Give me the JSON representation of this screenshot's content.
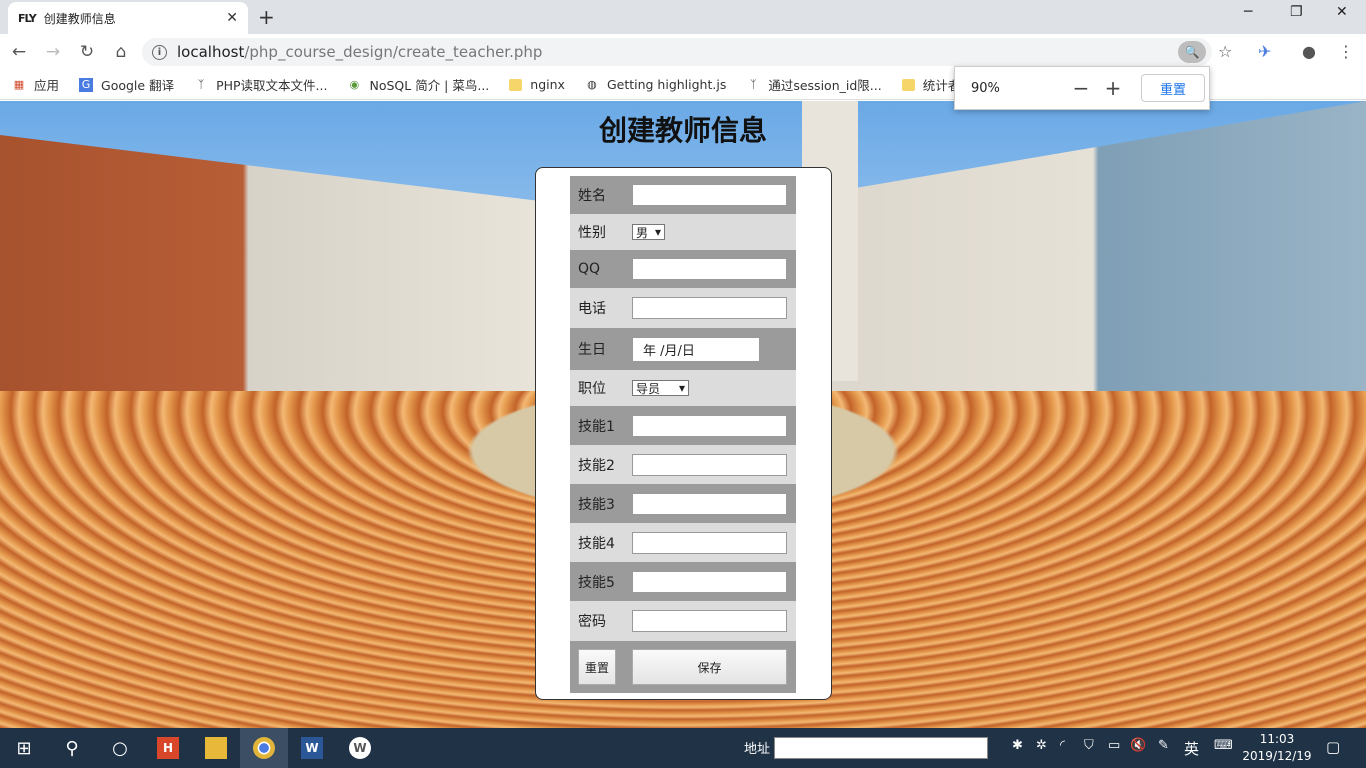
{
  "browser": {
    "tab": {
      "favicon": "FLY",
      "title": "创建教师信息",
      "close": "✕"
    },
    "new_tab": "+",
    "window_controls": [
      "─",
      "❐",
      "✕"
    ],
    "nav": {
      "back": "←",
      "forward": "→",
      "reload": "↻",
      "home": "⌂"
    },
    "url_host": "localhost",
    "url_path": "/php_course_design/create_teacher.php",
    "bookmarks": [
      {
        "icon": "apps-icon",
        "label": "应用"
      },
      {
        "icon": "google-translate-icon",
        "label": "Google 翻译"
      },
      {
        "icon": "link-icon",
        "label": "PHP读取文本文件..."
      },
      {
        "icon": "site-icon",
        "label": "NoSQL 简介 | 菜鸟..."
      },
      {
        "icon": "folder-icon",
        "label": "nginx"
      },
      {
        "icon": "globe-icon",
        "label": "Getting highlight.js"
      },
      {
        "icon": "link-icon",
        "label": "通过session_id限..."
      },
      {
        "icon": "folder-icon",
        "label": "统计者"
      }
    ],
    "zoom_popup": {
      "level": "90%",
      "minus": "−",
      "plus": "+",
      "reset_label": "重置"
    }
  },
  "page": {
    "title": "创建教师信息",
    "form": {
      "fields": [
        {
          "label": "姓名",
          "type": "text",
          "value": ""
        },
        {
          "label": "性别",
          "type": "select",
          "value": "男"
        },
        {
          "label": "QQ",
          "type": "text",
          "value": ""
        },
        {
          "label": "电话",
          "type": "text",
          "value": ""
        },
        {
          "label": "生日",
          "type": "date",
          "value": "年 /月/日"
        },
        {
          "label": "职位",
          "type": "select",
          "value": "导员"
        },
        {
          "label": "技能1",
          "type": "text",
          "value": ""
        },
        {
          "label": "技能2",
          "type": "text",
          "value": ""
        },
        {
          "label": "技能3",
          "type": "text",
          "value": ""
        },
        {
          "label": "技能4",
          "type": "text",
          "value": ""
        },
        {
          "label": "技能5",
          "type": "text",
          "value": ""
        },
        {
          "label": "密码",
          "type": "password",
          "value": ""
        }
      ],
      "reset_label": "重置",
      "save_label": "保存"
    }
  },
  "taskbar": {
    "address_label": "地址",
    "ime": "英",
    "time": "11:03",
    "date": "2019/12/19"
  }
}
